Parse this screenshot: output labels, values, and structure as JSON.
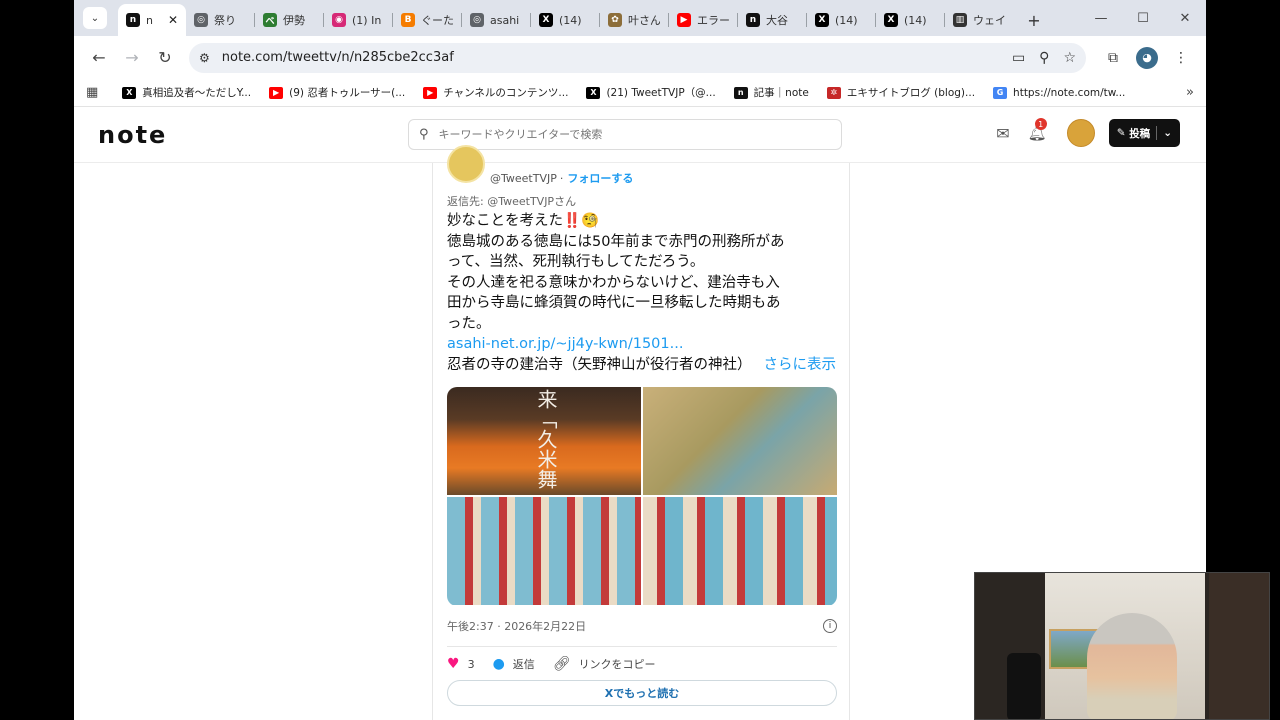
{
  "browser": {
    "tabs": [
      {
        "title": "n",
        "fav": "n",
        "color": "#111111",
        "active": true
      },
      {
        "title": "祭り",
        "fav": "◎",
        "color": "#5f6368"
      },
      {
        "title": "伊勢",
        "fav": "ベ",
        "color": "#2e7d32"
      },
      {
        "title": "(1) In",
        "fav": "◉",
        "color": "#d62976"
      },
      {
        "title": "ぐーた",
        "fav": "B",
        "color": "#f57c00"
      },
      {
        "title": "asahi",
        "fav": "◎",
        "color": "#5f6368"
      },
      {
        "title": "(14)",
        "fav": "X",
        "color": "#000000"
      },
      {
        "title": "叶さん",
        "fav": "✿",
        "color": "#8d6e3a"
      },
      {
        "title": "エラー",
        "fav": "▶",
        "color": "#ff0000"
      },
      {
        "title": "大谷",
        "fav": "n",
        "color": "#111111"
      },
      {
        "title": "(14)",
        "fav": "X",
        "color": "#000000"
      },
      {
        "title": "(14)",
        "fav": "X",
        "color": "#000000"
      },
      {
        "title": "ウェイ",
        "fav": "▥",
        "color": "#333333"
      }
    ],
    "new_tab": "+",
    "url": "note.com/tweettv/n/n285cbe2cc3af",
    "bookmarks": [
      {
        "label": "真相追及者〜ただしY...",
        "fav": "X",
        "color": "#000000"
      },
      {
        "label": "(9) 忍者トゥルーサー(...",
        "fav": "▶",
        "color": "#ff0000"
      },
      {
        "label": "チャンネルのコンテンツ...",
        "fav": "▶",
        "color": "#ff0000"
      },
      {
        "label": "(21) TweetTVJP（@...",
        "fav": "X",
        "color": "#000000"
      },
      {
        "label": "記事｜note",
        "fav": "n",
        "color": "#111111"
      },
      {
        "label": "エキサイトブログ (blog)...",
        "fav": "✲",
        "color": "#c62828"
      },
      {
        "label": "https://note.com/tw...",
        "fav": "G",
        "color": "#4285f4"
      }
    ]
  },
  "note": {
    "logo": "note",
    "search_placeholder": "キーワードやクリエイターで検索",
    "notification_count": "1",
    "post_label": "投稿"
  },
  "tweet": {
    "handle": "@TweetTVJP",
    "follow_label": "フォローする",
    "reply_to": "返信先: @TweetTVJPさん",
    "lines": [
      "妙なことを考えた‼️🧐",
      "徳島城のある徳島には50年前まで赤門の刑務所があ",
      "って、当然、死刑執行もしてただろう。",
      "その人達を祀る意味かわからないけど、建治寺も入",
      "田から寺島に蜂須賀の時代に一旦移転した時期もあ",
      "った。"
    ],
    "link": "asahi-net.or.jp/~jj4y-kwn/1501...",
    "link_title": "忍者の寺の建治寺（矢野神山が役行者の神社）",
    "show_more": "さらに表示",
    "media_caption_text": "来「久米舞",
    "timestamp": "午後2:37 · 2026年2月22日",
    "likes": "3",
    "reply_label": "返信",
    "copy_link_label": "リンクをコピー",
    "read_more": "Xでもっと読む"
  }
}
